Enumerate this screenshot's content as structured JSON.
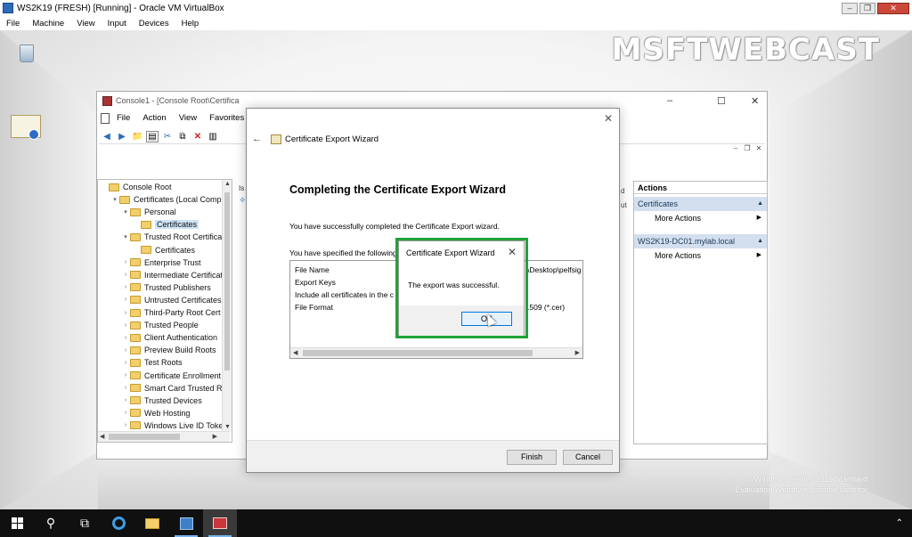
{
  "vbox": {
    "title": "WS2K19 (FRESH) [Running] - Oracle VM VirtualBox",
    "menu": [
      "File",
      "Machine",
      "View",
      "Input",
      "Devices",
      "Help"
    ]
  },
  "desktop": {
    "watermark": "MSFTWEBCAST",
    "license_line1": "Windows Server 2019 Standard",
    "license_line2": "Evaluation Windows License valid for"
  },
  "mmc": {
    "title": "Console1 - [Console Root\\Certifica",
    "menu": [
      "File",
      "Action",
      "View",
      "Favorites"
    ],
    "tree": [
      {
        "label": "Console Root",
        "level": 0,
        "arrow": ""
      },
      {
        "label": "Certificates (Local Compi",
        "level": 1,
        "arrow": "▾"
      },
      {
        "label": "Personal",
        "level": 2,
        "arrow": "▾"
      },
      {
        "label": "Certificates",
        "level": 3,
        "arrow": "",
        "selected": true
      },
      {
        "label": "Trusted Root Certifica",
        "level": 2,
        "arrow": "▾"
      },
      {
        "label": "Certificates",
        "level": 3,
        "arrow": ""
      },
      {
        "label": "Enterprise Trust",
        "level": 2,
        "arrow": "›"
      },
      {
        "label": "Intermediate Certificate",
        "level": 2,
        "arrow": "›"
      },
      {
        "label": "Trusted Publishers",
        "level": 2,
        "arrow": "›"
      },
      {
        "label": "Untrusted Certificates",
        "level": 2,
        "arrow": "›"
      },
      {
        "label": "Third-Party Root Cert",
        "level": 2,
        "arrow": "›"
      },
      {
        "label": "Trusted People",
        "level": 2,
        "arrow": "›"
      },
      {
        "label": "Client Authentication",
        "level": 2,
        "arrow": "›"
      },
      {
        "label": "Preview Build Roots",
        "level": 2,
        "arrow": "›"
      },
      {
        "label": "Test Roots",
        "level": 2,
        "arrow": "›"
      },
      {
        "label": "Certificate Enrollment",
        "level": 2,
        "arrow": "›"
      },
      {
        "label": "Smart Card Trusted R",
        "level": 2,
        "arrow": "›"
      },
      {
        "label": "Trusted Devices",
        "level": 2,
        "arrow": "›"
      },
      {
        "label": "Web Hosting",
        "level": 2,
        "arrow": "›"
      },
      {
        "label": "Windows Live ID Toke",
        "level": 2,
        "arrow": "›"
      }
    ],
    "center_fragment": "Is",
    "mid_fragment_1": "d",
    "mid_fragment_2": "ut",
    "actions": {
      "header": "Actions",
      "section1": "Certificates",
      "section1_item": "More Actions",
      "section2": "WS2K19-DC01.mylab.local",
      "section2_item": "More Actions"
    }
  },
  "wizard": {
    "title": "Certificate Export Wizard",
    "heading": "Completing the Certificate Export Wizard",
    "success_text": "You have successfully completed the Certificate Export wizard.",
    "specified_text": "You have specified the following",
    "summary_rows": [
      "File Name",
      "Export Keys",
      "Include all certificates in the c",
      "File Format"
    ],
    "summary_values": [
      "\\Desktop\\pelfsig",
      "",
      "",
      ".509 (*.cer)"
    ],
    "finish_label": "Finish",
    "cancel_label": "Cancel"
  },
  "msgbox": {
    "title": "Certificate Export Wizard",
    "message": "The export was successful.",
    "ok_label": "OK"
  },
  "colors": {
    "highlight": "#1fa339",
    "taskbar": "#101010",
    "selection": "#cde3f7",
    "actions_section": "#d3dfee"
  }
}
